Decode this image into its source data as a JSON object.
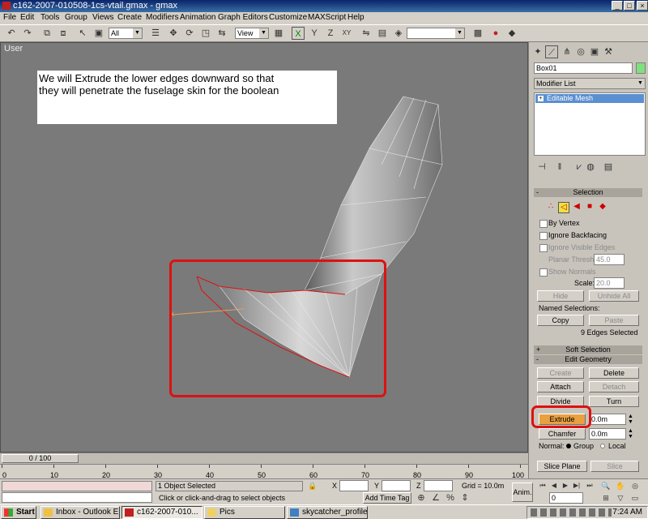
{
  "window": {
    "title": "c162-2007-010508-1cs-vtail.gmax - gmax",
    "min": "_",
    "max": "□",
    "close": "×"
  },
  "menu": [
    "File",
    "Edit",
    "Tools",
    "Group",
    "Views",
    "Create",
    "Modifiers",
    "Animation",
    "Graph Editors",
    "Customize",
    "MAXScript",
    "Help"
  ],
  "toolbar": {
    "selection_filter": "All",
    "ref_coord": "View"
  },
  "viewport": {
    "label": "User",
    "callout_line1": "We will Extrude the lower edges downward so that",
    "callout_line2": "they will penetrate the fuselage skin for the boolean"
  },
  "command_panel": {
    "object_name": "Box01",
    "modifier_list": "Modifier List",
    "stack_item": "Editable Mesh",
    "selection": {
      "title": "Selection",
      "by_vertex": "By Vertex",
      "ignore_backfacing": "Ignore Backfacing",
      "ignore_visible_edges": "Ignore Visible Edges",
      "planar_thresh_label": "Planar Thresh:",
      "planar_thresh_value": "45.0",
      "show_normals": "Show Normals",
      "scale_label": "Scale:",
      "scale_value": "20.0",
      "hide": "Hide",
      "unhide_all": "Unhide All",
      "named_selections": "Named Selections:",
      "copy": "Copy",
      "paste": "Paste",
      "status": "9 Edges Selected"
    },
    "soft_selection": {
      "title": "Soft Selection",
      "sign": "+"
    },
    "edit_geometry": {
      "title": "Edit Geometry",
      "sign": "-",
      "create": "Create",
      "delete": "Delete",
      "attach": "Attach",
      "detach": "Detach",
      "divide": "Divide",
      "turn": "Turn",
      "extrude": "Extrude",
      "extrude_value": "0.0m",
      "chamfer": "Chamfer",
      "chamfer_value": "0.0m",
      "normal_label": "Normal:",
      "group": "Group",
      "local": "Local",
      "slice_plane": "Slice Plane",
      "slice": "Slice"
    }
  },
  "timeline": {
    "frame": "0 / 100",
    "ticks": [
      "0",
      "10",
      "20",
      "30",
      "40",
      "50",
      "60",
      "70",
      "80",
      "90",
      "100"
    ]
  },
  "status": {
    "selected": "1 Object Selected",
    "prompt": "Click or click-and-drag to select objects",
    "x_label": "X",
    "y_label": "Y",
    "z_label": "Z",
    "grid": "Grid = 10.0m",
    "add_time_tag": "Add Time Tag",
    "anim": "Anim.",
    "frame_field": "0"
  },
  "taskbar": {
    "start": "Start",
    "tasks": [
      "Inbox - Outlook E...",
      "c162-2007-010...",
      "Pics",
      "skycatcher_profile..."
    ],
    "clock": "7:24 AM"
  },
  "colors": {
    "selection_red": "#dd1111",
    "extrude_orange": "#e8a040",
    "viewport_bg": "#7a7a7a"
  }
}
